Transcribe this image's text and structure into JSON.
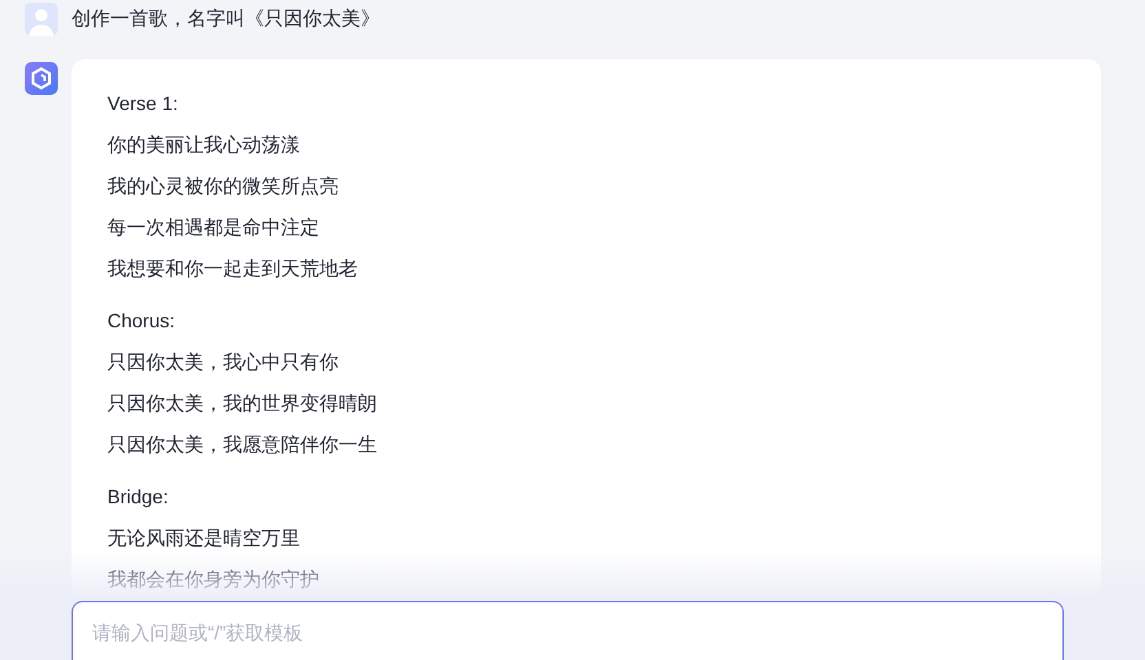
{
  "user_message": {
    "text": "创作一首歌，名字叫《只因你太美》"
  },
  "reply": {
    "sections": [
      {
        "heading": "Verse 1:",
        "lines": [
          "你的美丽让我心动荡漾",
          "我的心灵被你的微笑所点亮",
          "每一次相遇都是命中注定",
          "我想要和你一起走到天荒地老"
        ]
      },
      {
        "heading": "Chorus:",
        "lines": [
          "只因你太美，我心中只有你",
          "只因你太美，我的世界变得晴朗",
          "只因你太美，我愿意陪伴你一生"
        ]
      },
      {
        "heading": "Bridge:",
        "lines": [
          "无论风雨还是晴空万里",
          "我都会在你身旁为你守护"
        ]
      }
    ]
  },
  "input": {
    "placeholder": "请输入问题或“/”获取模板"
  }
}
